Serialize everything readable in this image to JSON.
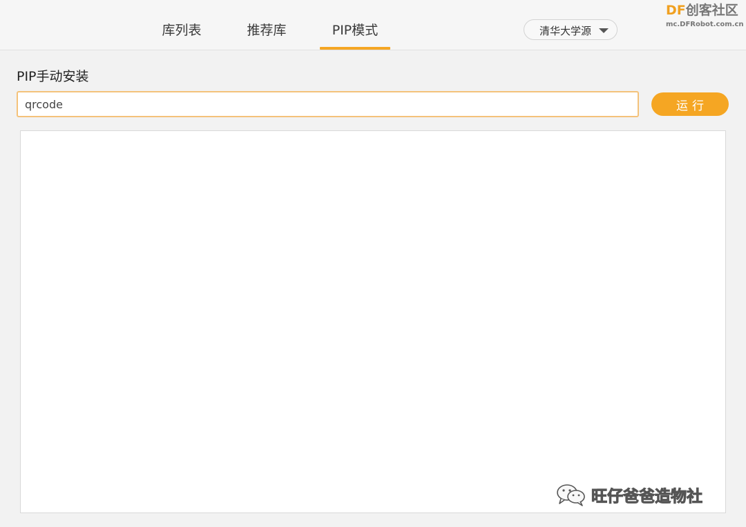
{
  "tabs": [
    {
      "label": "库列表",
      "active": false
    },
    {
      "label": "推荐库",
      "active": false
    },
    {
      "label": "PIP模式",
      "active": true
    }
  ],
  "source_select": {
    "selected": "清华大学源",
    "icon": "caret-down-icon"
  },
  "brand": {
    "name_prefix": "DF",
    "name_rest": "创客社区",
    "url": "mc.DFRobot.com.cn"
  },
  "pip": {
    "title": "PIP手动安装",
    "input_value": "qrcode",
    "run_label": "运行"
  },
  "watermark": {
    "icon": "wechat-icon",
    "text": "旺仔爸爸造物社"
  },
  "colors": {
    "accent": "#f5a623",
    "input_border": "#f4c27a",
    "background": "#f2f2f2"
  }
}
